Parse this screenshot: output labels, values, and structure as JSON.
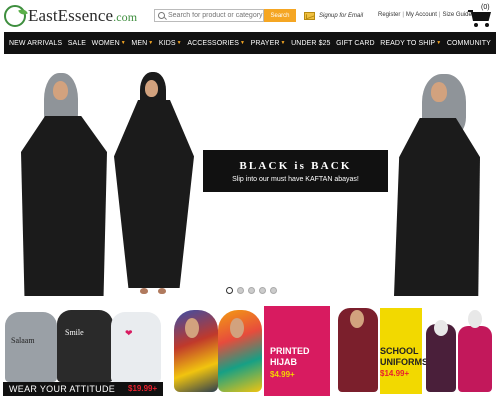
{
  "header": {
    "logo_text": "EastEssence",
    "logo_suffix": ".com",
    "search_placeholder": "Search for product or category",
    "search_button": "Search",
    "signup_text": "Signup for Email",
    "links": [
      "Register",
      "My Account",
      "Size Guide"
    ],
    "cart_count": "(0)"
  },
  "nav": {
    "items": [
      {
        "label": "NEW ARRIVALS",
        "caret": false
      },
      {
        "label": "SALE",
        "caret": false
      },
      {
        "label": "WOMEN",
        "caret": true
      },
      {
        "label": "MEN",
        "caret": true
      },
      {
        "label": "KIDS",
        "caret": true
      },
      {
        "label": "ACCESSORIES",
        "caret": true
      },
      {
        "label": "PRAYER",
        "caret": true
      },
      {
        "label": "UNDER $25",
        "caret": false
      },
      {
        "label": "GIFT CARD",
        "caret": false
      },
      {
        "label": "READY TO SHIP",
        "caret": true
      },
      {
        "label": "COMMUNITY",
        "caret": false
      }
    ]
  },
  "hero": {
    "title": "BLACK is BACK",
    "subtitle": "Slip into our must have KAFTAN abayas!",
    "slides": 5,
    "active_slide": 0
  },
  "promos": {
    "attitude": {
      "label": "WEAR YOUR ATTITUDE",
      "price": "$19.99+"
    },
    "hijab": {
      "title_line1": "PRINTED",
      "title_line2": "HIJAB",
      "price": "$4.99+"
    },
    "uniforms": {
      "title_line1": "SCHOOL",
      "title_line2": "UNIFORMS",
      "price": "$14.99+"
    }
  },
  "colors": {
    "accent": "#f5a623",
    "nav_bg": "#111111",
    "pink": "#d81b60",
    "yellow": "#f2d900",
    "price_red": "#e8202e"
  }
}
